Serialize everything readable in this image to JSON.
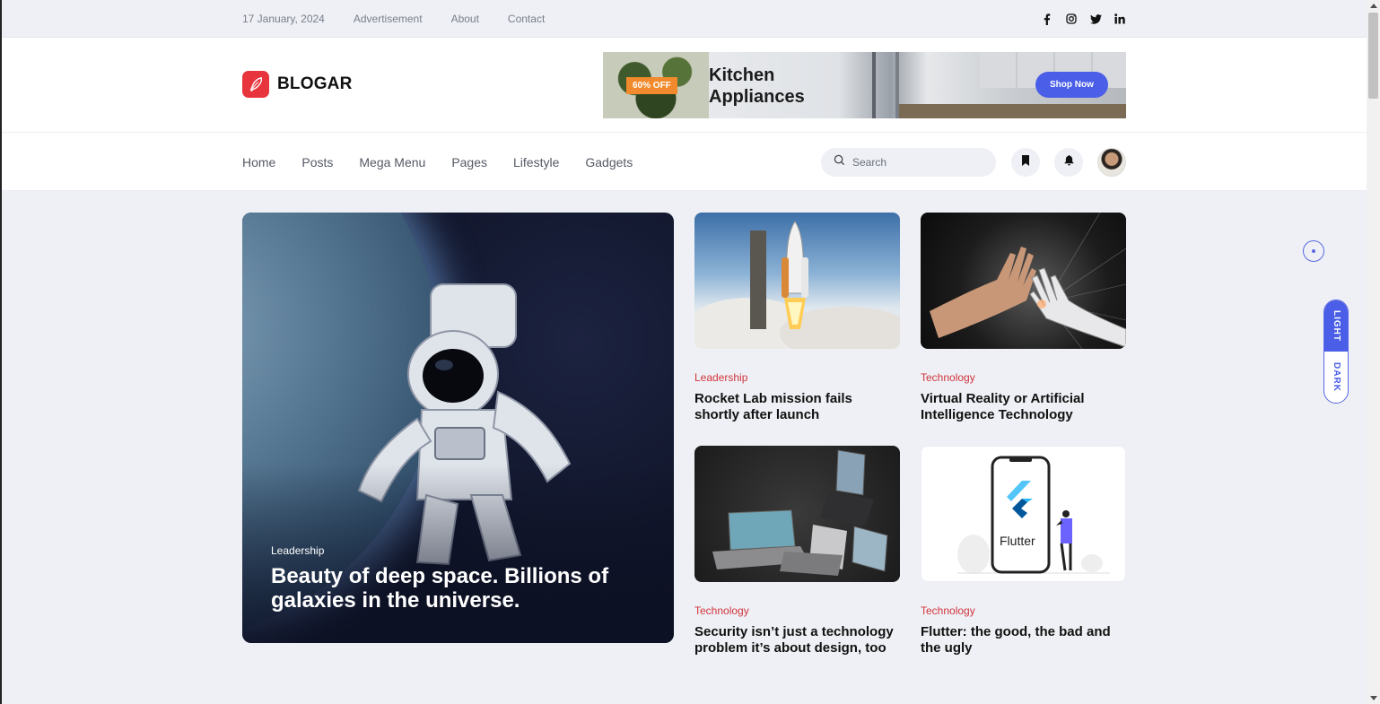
{
  "topbar": {
    "date": "17 January, 2024",
    "links": [
      "Advertisement",
      "About",
      "Contact"
    ],
    "social_icons": [
      "facebook-icon",
      "instagram-icon",
      "twitter-icon",
      "linkedin-icon"
    ]
  },
  "header": {
    "logo_text": "BLOGAR",
    "banner": {
      "badge": "60% OFF",
      "title": "Kitchen Appliances",
      "cta": "Shop Now"
    }
  },
  "nav": {
    "items": [
      "Home",
      "Posts",
      "Mega Menu",
      "Pages",
      "Lifestyle",
      "Gadgets"
    ],
    "search_placeholder": "Search"
  },
  "hero": {
    "category": "Leadership",
    "title": "Beauty of deep space. Billions of galaxies in the universe."
  },
  "cards": [
    {
      "category": "Leadership",
      "title": "Rocket Lab mission fails shortly after launch",
      "image": "rocket-launch"
    },
    {
      "category": "Technology",
      "title": "Virtual Reality or Artificial Intelligence Technology",
      "image": "robot-hand"
    },
    {
      "category": "Technology",
      "title": "Security isn’t just a technology problem it’s about design, too",
      "image": "laptops"
    },
    {
      "category": "Technology",
      "title": "Flutter: the good, the bad and the ugly",
      "image": "flutter-phone",
      "image_text": "Flutter"
    }
  ],
  "theme_switch": {
    "light": "LIGHT",
    "dark": "DARK"
  },
  "colors": {
    "accent": "#4a5ee8",
    "category": "#d1343c",
    "logo": "#e8343c",
    "badge": "#f08a2c"
  }
}
